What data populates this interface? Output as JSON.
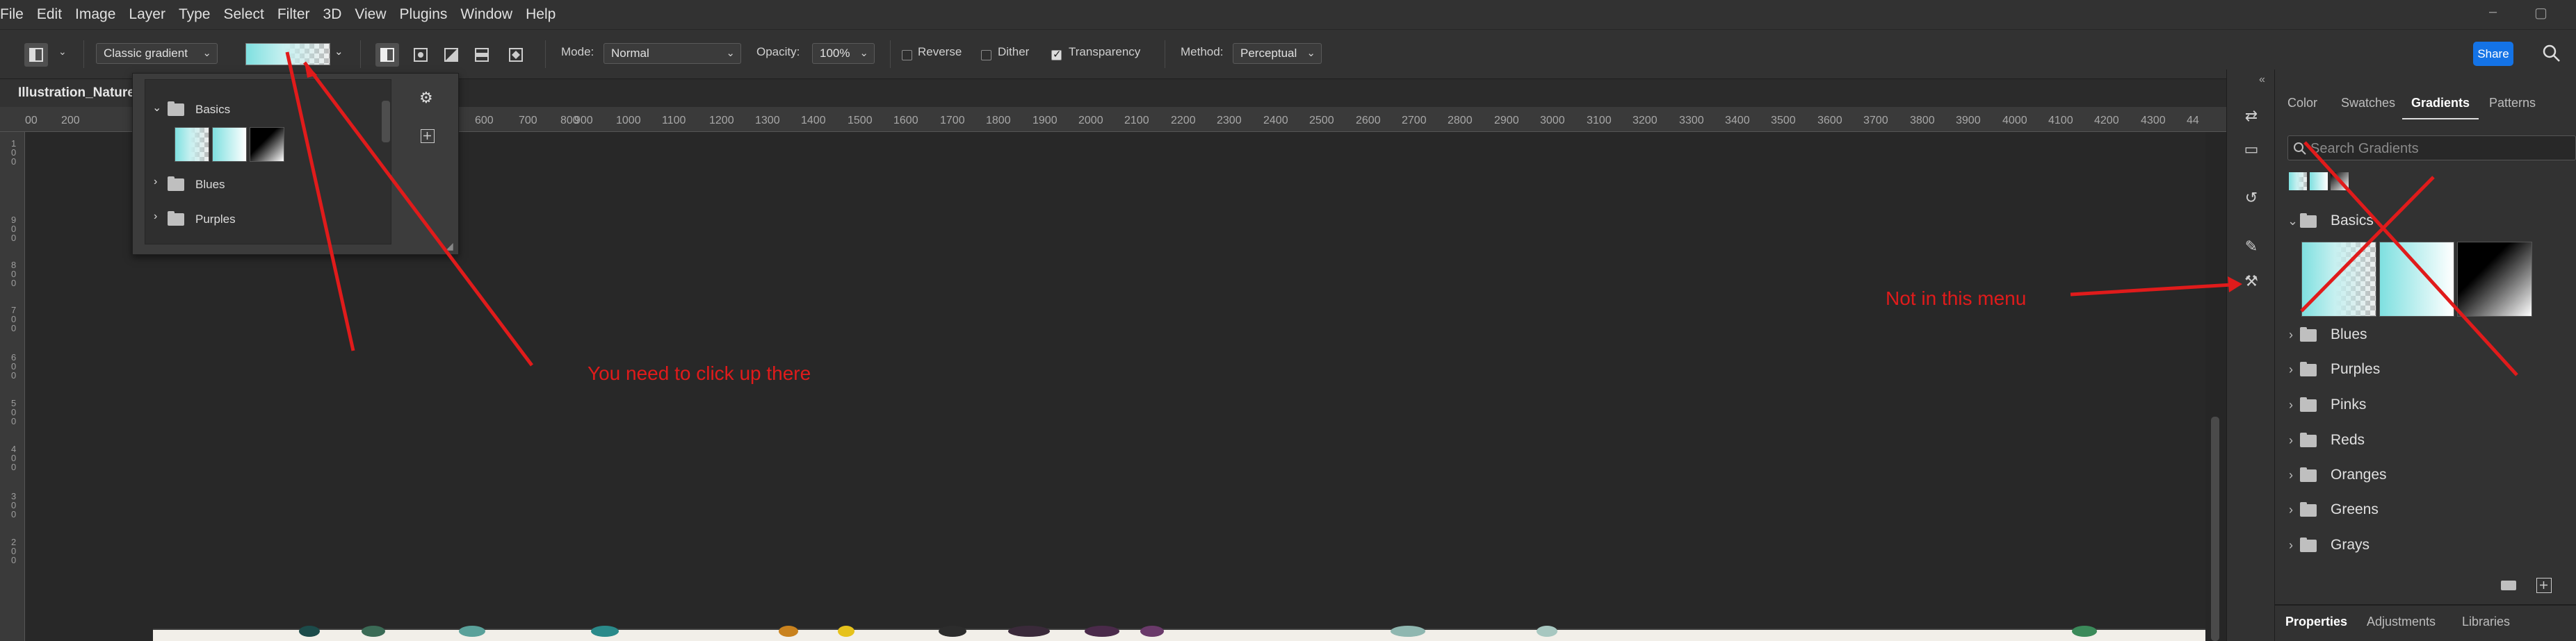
{
  "menu": [
    "File",
    "Edit",
    "Image",
    "Layer",
    "Type",
    "Select",
    "Filter",
    "3D",
    "View",
    "Plugins",
    "Window",
    "Help"
  ],
  "window_controls": [
    "–",
    "▢"
  ],
  "options": {
    "gradient_type": "Classic gradient",
    "mode_label": "Mode:",
    "mode_value": "Normal",
    "opacity_label": "Opacity:",
    "opacity_value": "100%",
    "reverse_label": "Reverse",
    "dither_label": "Dither",
    "transparency_label": "Transparency",
    "method_label": "Method:",
    "method_value": "Perceptual",
    "share_label": "Share",
    "reverse_checked": false,
    "dither_checked": false,
    "transparency_checked": true
  },
  "document": {
    "tab_title": "Illustration_Nature"
  },
  "ruler": {
    "h_ticks": [
      "00",
      "200",
      "600",
      "700",
      "800",
      "900",
      "1000",
      "1100",
      "1200",
      "1300",
      "1400",
      "1500",
      "1600",
      "1700",
      "1800",
      "1900",
      "2000",
      "2100",
      "2200",
      "2300",
      "2400",
      "2500",
      "2600",
      "2700",
      "2800",
      "2900",
      "3000",
      "3100",
      "3200",
      "3300",
      "3400",
      "3500",
      "3600",
      "3700",
      "3800",
      "3900",
      "4000",
      "4100",
      "4200",
      "4300",
      "44"
    ],
    "v_ticks": [
      "100",
      "900",
      "800",
      "700",
      "600",
      "500",
      "400",
      "300",
      "200"
    ]
  },
  "gradient_popup": {
    "groups": [
      {
        "name": "Basics",
        "expanded": true
      },
      {
        "name": "Blues",
        "expanded": false
      },
      {
        "name": "Purples",
        "expanded": false
      }
    ]
  },
  "panel": {
    "tabs": [
      "Color",
      "Swatches",
      "Gradients",
      "Patterns"
    ],
    "active_tab": "Gradients",
    "search_placeholder": "Search Gradients",
    "groups": [
      "Basics",
      "Blues",
      "Purples",
      "Pinks",
      "Reds",
      "Oranges",
      "Greens",
      "Grays"
    ],
    "bottom_tabs": [
      "Properties",
      "Adjustments",
      "Libraries"
    ]
  },
  "annotations": {
    "click_hint": "You need to click up there",
    "not_here": "Not in this menu"
  },
  "colors": {
    "annotation_red": "#e01b1b",
    "share_blue": "#1473e6",
    "cyan_gradient": "#7fe0e0"
  }
}
